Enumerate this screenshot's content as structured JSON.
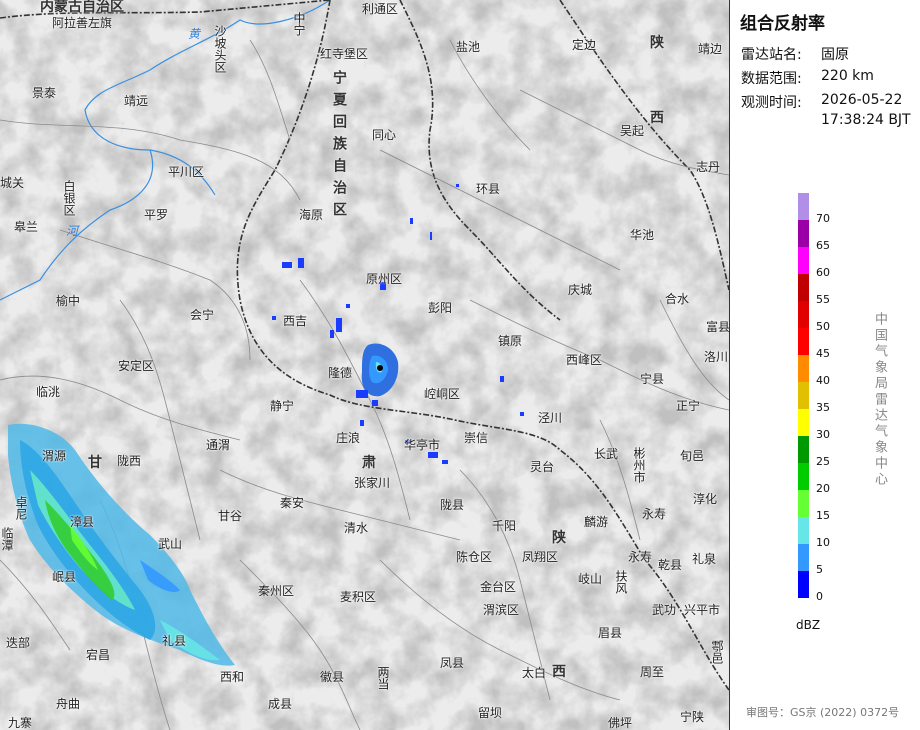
{
  "panel": {
    "title": "组合反射率",
    "station_label": "雷达站名:",
    "station_value": "固原",
    "range_label": "数据范围:",
    "range_value": "220 km",
    "time_label": "观测时间:",
    "time_value_date": "2026-05-22",
    "time_value_clock": "17:38:24 BJT",
    "unit": "dBZ",
    "credit": "中国气象局雷达气象中心",
    "gs_number": "审图号：GS京 (2022) 0372号"
  },
  "legend": [
    {
      "value": "70",
      "color": "#b18fe6"
    },
    {
      "value": "65",
      "color": "#9b00a6"
    },
    {
      "value": "60",
      "color": "#ff00ff"
    },
    {
      "value": "55",
      "color": "#c00000"
    },
    {
      "value": "50",
      "color": "#e00000"
    },
    {
      "value": "45",
      "color": "#ff0000"
    },
    {
      "value": "40",
      "color": "#ff8c00"
    },
    {
      "value": "35",
      "color": "#e0c000"
    },
    {
      "value": "30",
      "color": "#ffff00"
    },
    {
      "value": "25",
      "color": "#009900"
    },
    {
      "value": "20",
      "color": "#00cc00"
    },
    {
      "value": "15",
      "color": "#66ff33"
    },
    {
      "value": "10",
      "color": "#66e6e6"
    },
    {
      "value": "5",
      "color": "#3399ff"
    },
    {
      "value": "0",
      "color": "#0000ff"
    }
  ],
  "map": {
    "regions": {
      "neimenggu": "内蒙古自治区",
      "ningxia": "宁夏回族自治区",
      "gansu1": "甘",
      "gansu2": "肃",
      "shaanxi_a1": "陕",
      "shaanxi_a2": "西",
      "shaanxi_b1": "陕",
      "shaanxi_b2": "西"
    },
    "places": {
      "alashan": "阿拉善左旗",
      "shapotou": "沙坡头区",
      "zhongning": "中宁",
      "litong": "利通区",
      "hongsibao": "红寺堡区",
      "yanchi": "盐池",
      "dingbian": "定边",
      "jingbian": "靖边",
      "jingtai": "景泰",
      "jingyuan": "靖远",
      "tongxin": "同心",
      "wuqi": "吴起",
      "baiyin": "白银区",
      "pingchuan": "平川区",
      "zhidan": "志丹",
      "huanxian": "环县",
      "haiyuan": "海原",
      "gaolan": "皋兰",
      "chengguan": "城关",
      "pingluo": "平罗",
      "huachi": "华池",
      "yuanzhou": "原州区",
      "qingcheng": "庆城",
      "heshui": "合水",
      "yuzhong": "榆中",
      "pengyang": "彭阳",
      "huining": "会宁",
      "xiji": "西吉",
      "zhenyuan": "镇原",
      "fuxian": "富县",
      "xifeng": "西峰区",
      "anding": "安定区",
      "longde": "隆德",
      "ningxian": "宁县",
      "lintao": "临洮",
      "kongtong": "崆峒区",
      "luochuan": "洛川",
      "zhengning": "正宁",
      "jingning": "静宁",
      "jingchuan": "泾川",
      "tongwei": "通渭",
      "zhuanglang": "庄浪",
      "huating": "华亭市",
      "chongxin": "崇信",
      "changwu": "长武",
      "binzhou": "彬州市",
      "xunyi": "旬邑",
      "weiyuan": "渭源",
      "longxi": "陇西",
      "lingtai": "灵台",
      "zhangjiachuan": "张家川",
      "longxian": "陇县",
      "chunhua": "淳化",
      "zhangxian": "漳县",
      "qinan": "秦安",
      "linyou": "麟游",
      "yongshou": "永寿",
      "gangu": "甘谷",
      "qingshui": "清水",
      "qianyang": "千阳",
      "min": "岷县",
      "wushan": "武山",
      "chencang": "陈仓区",
      "fengxiang": "凤翔区",
      "qishan": "岐山",
      "fufeng": "扶风",
      "qianxian": "乾县",
      "liquan": "礼泉",
      "zhuoni": "卓尼",
      "lintan": "临潭",
      "tanchang": "宕昌",
      "qinzhou": "秦州区",
      "maiji": "麦积区",
      "jintai": "金台区",
      "weibin": "渭滨区",
      "wugong": "武功",
      "xingping": "兴平市",
      "diebu": "迭部",
      "lixian": "礼县",
      "meixian": "眉县",
      "zhouzhi": "周至",
      "huxian": "鄠邑",
      "zhouqu": "舟曲",
      "xihe": "西和",
      "huixian": "徽县",
      "liangdang": "两当",
      "fengxian": "凤县",
      "taibai": "太白",
      "chengxian": "成县",
      "liuba": "留坝",
      "foping": "佛坪",
      "ningshan": "宁陕",
      "jiuzhai": "九寨",
      "lanzhou_label": "兰",
      "zhou_label": "州",
      "yellow_river1": "黄",
      "yellow_river2": "河"
    }
  }
}
